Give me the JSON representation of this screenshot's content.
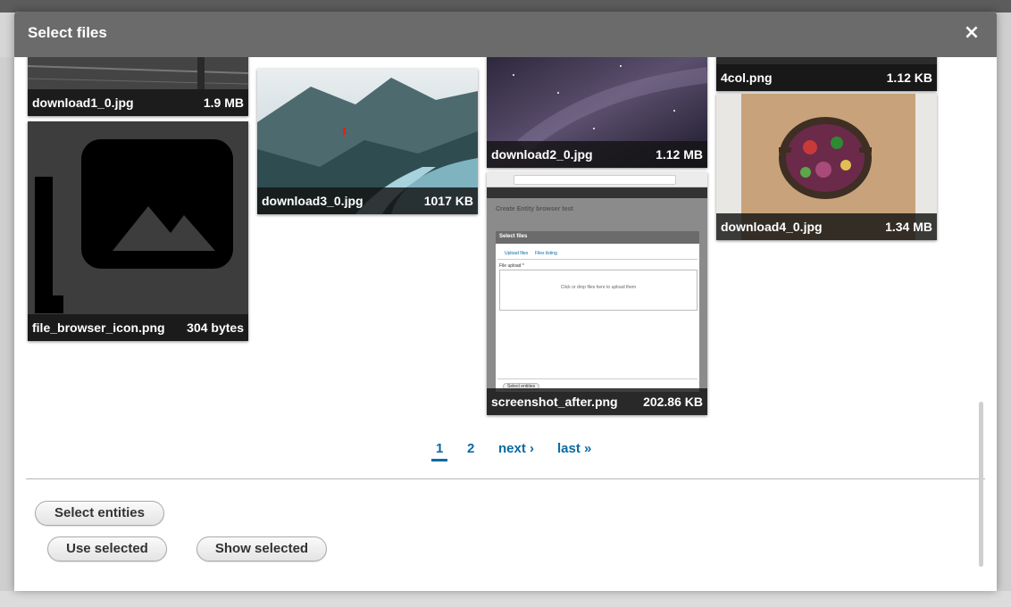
{
  "dialog": {
    "title": "Select files",
    "close_label": "×"
  },
  "files": [
    {
      "name": "download1_0.jpg",
      "size": "1.9 MB"
    },
    {
      "name": "file_browser_icon.png",
      "size": "304 bytes"
    },
    {
      "name": "download3_0.jpg",
      "size": "1017 KB"
    },
    {
      "name": "download2_0.jpg",
      "size": "1.12 MB"
    },
    {
      "name": "screenshot_after.png",
      "size": "202.86 KB"
    },
    {
      "name": "4col.png",
      "size": "1.12 KB"
    },
    {
      "name": "download4_0.jpg",
      "size": "1.34 MB"
    }
  ],
  "pager": {
    "current": "1",
    "page2": "2",
    "next": "next ›",
    "last": "last »"
  },
  "buttons": {
    "select_entities": "Select entities",
    "use_selected": "Use selected",
    "show_selected": "Show selected"
  },
  "screenshot_preview": {
    "header": "Create Entity browser test",
    "dialog_title": "Select files",
    "tab_upload": "Upload files",
    "tab_listing": "Files listing",
    "file_upload_label": "File upload *",
    "dropzone_text": "Click or drop files here to upload them",
    "button": "Select entities"
  },
  "colors": {
    "titlebar": "#6b6b6b",
    "link": "#0a6aa1"
  }
}
